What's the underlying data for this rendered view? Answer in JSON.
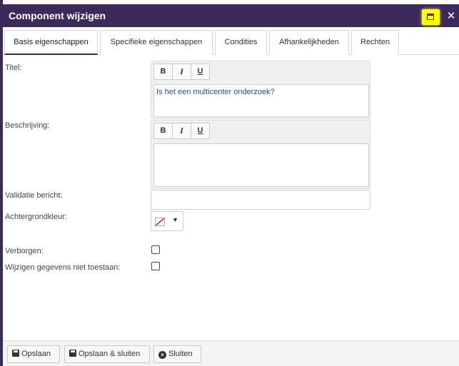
{
  "dialog": {
    "title": "Component wijzigen",
    "maximize_icon": "maximize-icon",
    "close_label": "✕",
    "colors": {
      "titlebar": "#3d2a5c",
      "highlight": "#ffff00"
    }
  },
  "tabs": [
    {
      "label": "Basis eigenschappen",
      "active": true
    },
    {
      "label": "Specifieke eigenschappen",
      "active": false
    },
    {
      "label": "Condities",
      "active": false
    },
    {
      "label": "Afhankelijkheden",
      "active": false
    },
    {
      "label": "Rechten",
      "active": false
    }
  ],
  "form": {
    "titel": {
      "label": "Titel:",
      "toolbar": {
        "bold": "B",
        "italic": "I",
        "underline": "U"
      },
      "value": "Is het een multicenter onderzoek?"
    },
    "beschrijving": {
      "label": "Beschrijving:",
      "toolbar": {
        "bold": "B",
        "italic": "I",
        "underline": "U"
      },
      "value": ""
    },
    "validatie": {
      "label": "Validatie bericht:",
      "value": ""
    },
    "achtergrondkleur": {
      "label": "Achtergrondkleur:",
      "caret": "▼"
    },
    "verborgen": {
      "label": "Verborgen:",
      "checked": false
    },
    "wijzigen": {
      "label": "Wijzigen gegevens niet toestaan:",
      "checked": false
    }
  },
  "footer": {
    "save": "Opslaan",
    "save_close": "Opslaan & sluiten",
    "close": "Sluiten"
  }
}
